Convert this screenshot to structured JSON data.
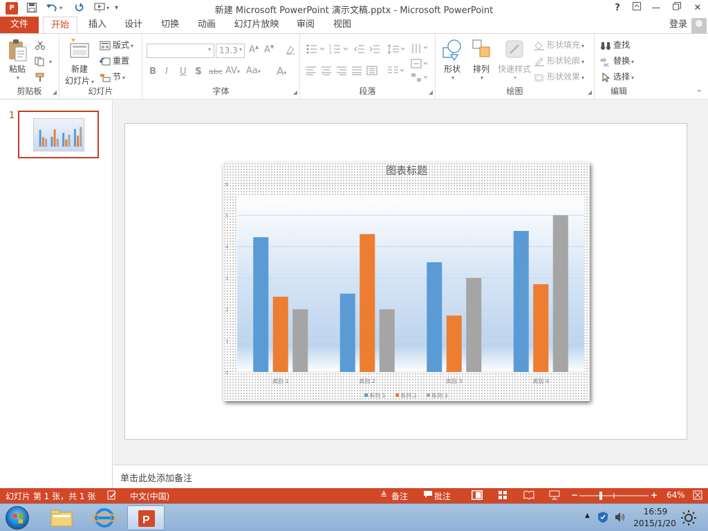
{
  "titlebar": {
    "app_icon": "P",
    "title": "新建 Microsoft PowerPoint 演示文稿.pptx - Microsoft PowerPoint",
    "help": "?",
    "icons": [
      "save-icon",
      "undo-icon",
      "redo-icon",
      "presentation-icon"
    ]
  },
  "tabs": {
    "file": "文件",
    "items": [
      "开始",
      "插入",
      "设计",
      "切换",
      "动画",
      "幻灯片放映",
      "审阅",
      "视图"
    ],
    "active": "开始",
    "login": "登录"
  },
  "ribbon": {
    "clipboard": {
      "paste": "粘贴",
      "label": "剪贴板"
    },
    "slides": {
      "new_slide_line1": "新建",
      "new_slide_line2": "幻灯片",
      "layout": "版式",
      "reset": "重置",
      "section": "节",
      "label": "幻灯片"
    },
    "font": {
      "font_name": "",
      "font_size": "13.3",
      "bold": "B",
      "italic": "I",
      "underline": "U",
      "shadow": "S",
      "strike": "abc",
      "label": "字体"
    },
    "paragraph": {
      "label": "段落"
    },
    "drawing": {
      "shapes": "形状",
      "arrange": "排列",
      "quick_styles": "快速样式",
      "shape_fill": "形状填充",
      "shape_outline": "形状轮廓",
      "shape_effects": "形状效果",
      "label": "绘图"
    },
    "editing": {
      "find": "查找",
      "replace": "替换",
      "select": "选择",
      "label": "编辑"
    }
  },
  "thumbnails": {
    "slide_number": "1"
  },
  "chart_data": {
    "type": "bar",
    "title": "图表标题",
    "categories": [
      "类别 1",
      "类别 2",
      "类别 3",
      "类别 4"
    ],
    "series": [
      {
        "name": "系列 1",
        "values": [
          4.3,
          2.5,
          3.5,
          4.5
        ],
        "color": "#5b9bd5"
      },
      {
        "name": "系列 2",
        "values": [
          2.4,
          4.4,
          1.8,
          2.8
        ],
        "color": "#ed7d31"
      },
      {
        "name": "系列 3",
        "values": [
          2.0,
          2.0,
          3.0,
          5.0
        ],
        "color": "#a5a5a5"
      }
    ],
    "ylim": [
      0,
      6
    ],
    "yticks": [
      "0",
      "1",
      "2",
      "3",
      "4",
      "5",
      "6"
    ],
    "grid": true,
    "legend": "bottom"
  },
  "notes": {
    "placeholder": "单击此处添加备注"
  },
  "statusbar": {
    "slide_info": "幻灯片 第 1 张，共 1 张",
    "language": "中文(中国)",
    "notes": "备注",
    "comments": "批注",
    "zoom": "64%"
  },
  "taskbar": {
    "time": "16:59",
    "date": "2015/1/20"
  },
  "colors": {
    "accent": "#d24726",
    "series1": "#5b9bd5",
    "series2": "#ed7d31",
    "series3": "#a5a5a5"
  }
}
